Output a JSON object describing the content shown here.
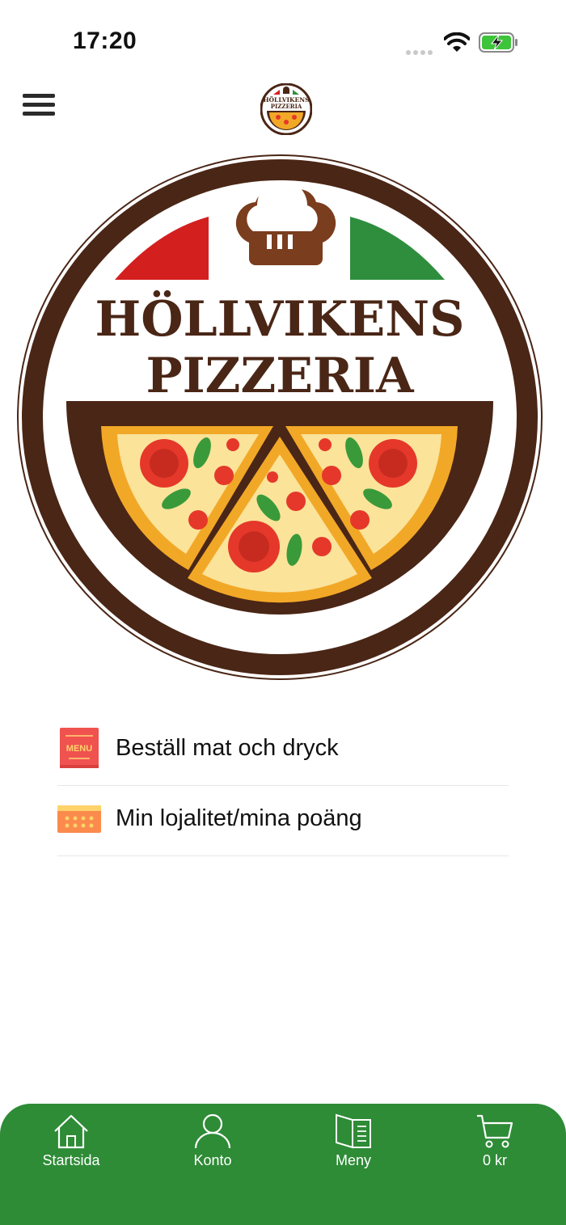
{
  "status_bar": {
    "time": "17:20",
    "icons": [
      "cellular-signal-icon",
      "wifi-icon",
      "battery-charging-icon"
    ]
  },
  "header": {
    "menu_icon": "hamburger-menu-icon",
    "logo_text_line1": "HÖLLVIKENS",
    "logo_text_line2": "PIZZERIA"
  },
  "hero_logo": {
    "line1": "HÖLLVIKENS",
    "line2": "PIZZERIA"
  },
  "actions": [
    {
      "label": "Beställ mat och dryck",
      "icon": "menu-book-icon",
      "icon_text": "MENU"
    },
    {
      "label": "Min lojalitet/mina poäng",
      "icon": "loyalty-card-icon"
    }
  ],
  "tab_bar": {
    "tabs": [
      {
        "label": "Startsida",
        "icon": "home-icon"
      },
      {
        "label": "Konto",
        "icon": "account-icon"
      },
      {
        "label": "Meny",
        "icon": "menu-book-icon"
      },
      {
        "label": "0 kr",
        "icon": "cart-icon"
      }
    ]
  },
  "colors": {
    "brand_green": "#2e8b36",
    "logo_brown": "#4a2616",
    "flag_red": "#d41f1f",
    "flag_green": "#2e8e3e",
    "pizza_crust": "#f2a827",
    "pizza_cheese": "#fbe39a",
    "tomato": "#e5382a",
    "basil": "#3a9a3a",
    "menu_icon_red": "#f0524f",
    "loyalty_icon_orange": "#fb8a4d"
  }
}
